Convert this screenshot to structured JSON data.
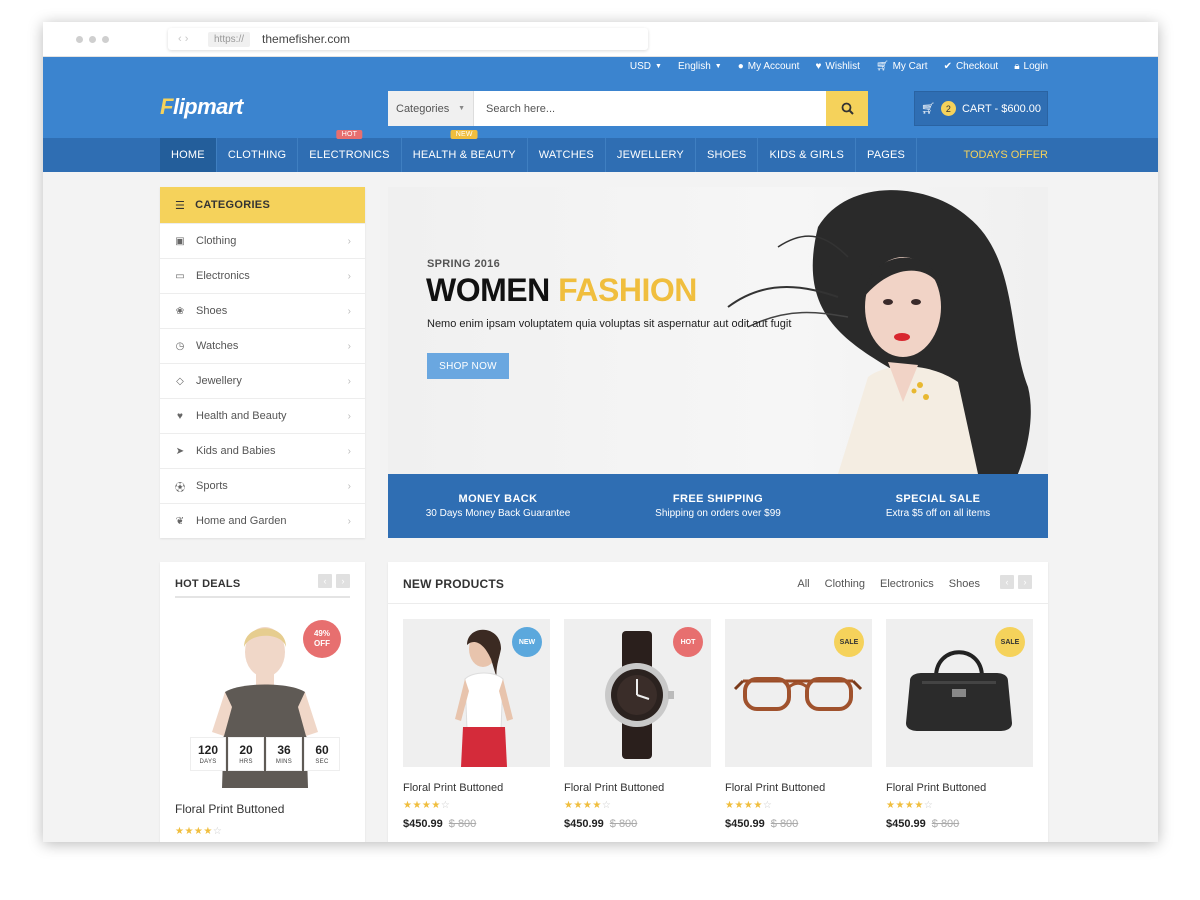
{
  "browser": {
    "protocol": "https://",
    "domain": "themefisher.com"
  },
  "topbar": {
    "currency": "USD",
    "language": "English",
    "account": "My Account",
    "wishlist": "Wishlist",
    "cart": "My Cart",
    "checkout": "Checkout",
    "login": "Login"
  },
  "logo": {
    "mark": "F",
    "text": "lipmart"
  },
  "search": {
    "category": "Categories",
    "placeholder": "Search here..."
  },
  "cart": {
    "count": "2",
    "label": "CART - $600.00"
  },
  "nav": {
    "items": [
      {
        "label": "HOME"
      },
      {
        "label": "CLOTHING"
      },
      {
        "label": "ELECTRONICS",
        "badge": "HOT"
      },
      {
        "label": "HEALTH & BEAUTY",
        "badge": "NEW"
      },
      {
        "label": "WATCHES"
      },
      {
        "label": "JEWELLERY"
      },
      {
        "label": "SHOES"
      },
      {
        "label": "KIDS & GIRLS"
      },
      {
        "label": "PAGES"
      }
    ],
    "offer": "TODAYS OFFER"
  },
  "categories": {
    "title": "CATEGORIES",
    "items": [
      {
        "label": "Clothing",
        "icon": "shopping-bag-icon"
      },
      {
        "label": "Electronics",
        "icon": "laptop-icon"
      },
      {
        "label": "Shoes",
        "icon": "paw-icon"
      },
      {
        "label": "Watches",
        "icon": "clock-icon"
      },
      {
        "label": "Jewellery",
        "icon": "diamond-icon"
      },
      {
        "label": "Health and Beauty",
        "icon": "heartbeat-icon"
      },
      {
        "label": "Kids and Babies",
        "icon": "paper-plane-icon"
      },
      {
        "label": "Sports",
        "icon": "soccer-ball-icon"
      },
      {
        "label": "Home and Garden",
        "icon": "leaf-icon"
      }
    ]
  },
  "banner": {
    "kicker": "SPRING 2016",
    "title_a": "WOMEN",
    "title_b": "FASHION",
    "subtitle": "Nemo enim ipsam voluptatem quia voluptas sit aspernatur aut odit aut fugit",
    "button": "SHOP NOW"
  },
  "features": [
    {
      "title": "MONEY BACK",
      "sub": "30 Days Money Back Guarantee"
    },
    {
      "title": "FREE SHIPPING",
      "sub": "Shipping on orders over $99"
    },
    {
      "title": "SPECIAL SALE",
      "sub": "Extra $5 off on all items"
    }
  ],
  "hot_deals": {
    "title": "HOT DEALS",
    "discount_pct": "49%",
    "discount_word": "OFF",
    "countdown": [
      {
        "value": "120",
        "unit": "DAYS"
      },
      {
        "value": "20",
        "unit": "HRS"
      },
      {
        "value": "36",
        "unit": "MINS"
      },
      {
        "value": "60",
        "unit": "SEC"
      }
    ],
    "product_name": "Floral Print Buttoned",
    "rating": 4
  },
  "new_products": {
    "title": "NEW PRODUCTS",
    "filters": [
      "All",
      "Clothing",
      "Electronics",
      "Shoes"
    ],
    "items": [
      {
        "name": "Floral Print Buttoned",
        "badge": "NEW",
        "price": "$450.99",
        "old_price": "$ 800",
        "rating": 4
      },
      {
        "name": "Floral Print Buttoned",
        "badge": "HOT",
        "price": "$450.99",
        "old_price": "$ 800",
        "rating": 4
      },
      {
        "name": "Floral Print Buttoned",
        "badge": "SALE",
        "price": "$450.99",
        "old_price": "$ 800",
        "rating": 4
      },
      {
        "name": "Floral Print Buttoned",
        "badge": "SALE",
        "price": "$450.99",
        "old_price": "$ 800",
        "rating": 4
      }
    ]
  },
  "colors": {
    "primary": "#3b84cf",
    "nav": "#2f6eb3",
    "accent": "#f5d25b",
    "hot": "#e76f6f",
    "new": "#5ba8dd",
    "sale": "#f5d25b"
  }
}
